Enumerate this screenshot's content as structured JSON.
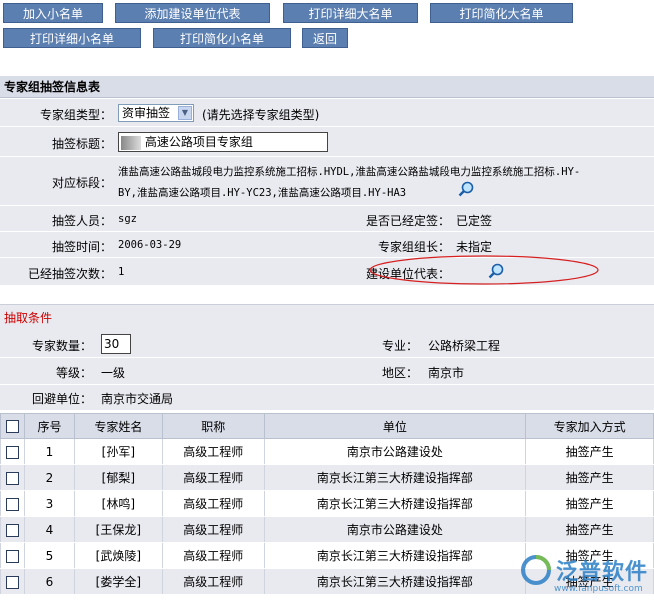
{
  "toolbar": {
    "add_member": "加入小名单",
    "add_rep": "添加建设单位代表",
    "print_detail_big": "打印详细大名单",
    "print_simple_big": "打印简化大名单",
    "print_detail_small": "打印详细小名单",
    "print_simple_small": "打印简化小名单",
    "back": "返回"
  },
  "info": {
    "title": "专家组抽签信息表",
    "group_type_label": "专家组类型：",
    "group_type_value": "资审抽签",
    "group_type_hint": "(请先选择专家组类型)",
    "draw_title_label": "抽签标题：",
    "draw_title_value": "高速公路项目专家组",
    "sections_label": "对应标段：",
    "sections_line1": "淮盐高速公路盐城段电力监控系统施工招标.HYDL,淮盐高速公路盐城段电力监控系统施工招标.HY-",
    "sections_line2": "BY,淮盐高速公路项目.HY-YC23,淮盐高速公路项目.HY-HA3",
    "drawer_label": "抽签人员：",
    "drawer_value": "sgz",
    "confirmed_label": "是否已经定签：",
    "confirmed_value": "已定签",
    "date_label": "抽签时间：",
    "date_value": "2006-03-29",
    "leader_label": "专家组组长：",
    "leader_value": "未指定",
    "count_label": "已经抽签次数：",
    "count_value": "1",
    "rep_label": "建设单位代表："
  },
  "conditions": {
    "title": "抽取条件",
    "qty_label": "专家数量：",
    "qty_value": "30",
    "major_label": "专业：",
    "major_value": "公路桥梁工程",
    "grade_label": "等级：",
    "grade_value": "一级",
    "region_label": "地区：",
    "region_value": "南京市",
    "avoid_label": "回避单位：",
    "avoid_value": "南京市交通局"
  },
  "table": {
    "headers": [
      "序号",
      "专家姓名",
      "职称",
      "单位",
      "专家加入方式"
    ],
    "rows": [
      {
        "no": "1",
        "name": "[孙军]",
        "title": "高级工程师",
        "unit": "南京市公路建设处",
        "method": "抽签产生"
      },
      {
        "no": "2",
        "name": "[郁梨]",
        "title": "高级工程师",
        "unit": "南京长江第三大桥建设指挥部",
        "method": "抽签产生"
      },
      {
        "no": "3",
        "name": "[林鸣]",
        "title": "高级工程师",
        "unit": "南京长江第三大桥建设指挥部",
        "method": "抽签产生"
      },
      {
        "no": "4",
        "name": "[王保龙]",
        "title": "高级工程师",
        "unit": "南京市公路建设处",
        "method": "抽签产生"
      },
      {
        "no": "5",
        "name": "[武焕陵]",
        "title": "高级工程师",
        "unit": "南京长江第三大桥建设指挥部",
        "method": "抽签产生"
      },
      {
        "no": "6",
        "name": "[娄学全]",
        "title": "高级工程师",
        "unit": "南京长江第三大桥建设指挥部",
        "method": "抽签产生"
      }
    ]
  },
  "watermark": {
    "brand": "泛普软件",
    "url": "www.fanpusoft.com"
  },
  "colors": {
    "button": "#5b7fb0",
    "row_bg": "#e9eaf0",
    "section_head": "#d9dde8",
    "accent_red": "#cc0000",
    "ellipse": "#d62020"
  }
}
